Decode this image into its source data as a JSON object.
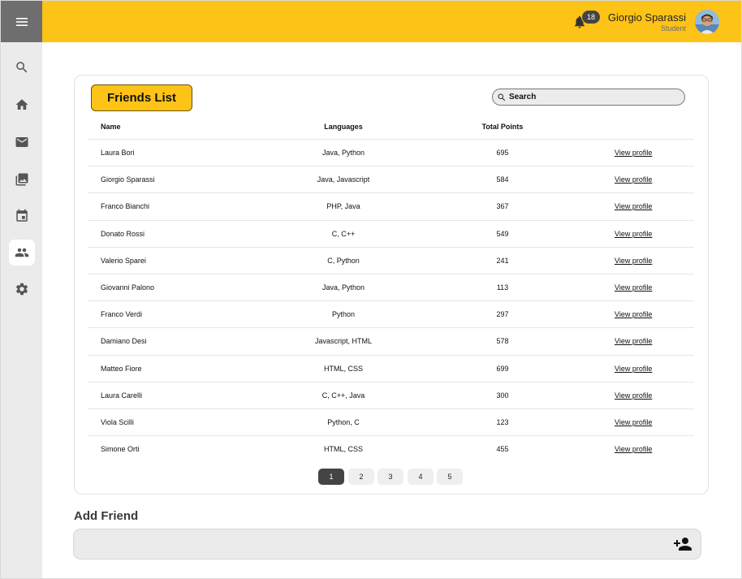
{
  "header": {
    "notifications_count": "18",
    "user_name": "Giorgio Sparassi",
    "user_role": "Student"
  },
  "sidebar": {
    "items": [
      {
        "icon": "search-icon"
      },
      {
        "icon": "home-icon"
      },
      {
        "icon": "mail-icon"
      },
      {
        "icon": "gallery-icon"
      },
      {
        "icon": "calendar-icon"
      },
      {
        "icon": "friends-icon",
        "active": true
      },
      {
        "icon": "settings-icon"
      }
    ]
  },
  "friends": {
    "title": "Friends List",
    "search_placeholder": "Search",
    "columns": [
      "Name",
      "Languages",
      "Total Points"
    ],
    "rows": [
      {
        "name": "Laura Bori",
        "languages": "Java, Python",
        "points": "695",
        "action": "View profile"
      },
      {
        "name": "Giorgio Sparassi",
        "languages": "Java, Javascript",
        "points": "584",
        "action": "View profile"
      },
      {
        "name": "Franco Bianchi",
        "languages": "PHP, Java",
        "points": "367",
        "action": "View profile"
      },
      {
        "name": "Donato Rossi",
        "languages": "C, C++",
        "points": "549",
        "action": "View profile"
      },
      {
        "name": "Valerio Sparei",
        "languages": "C, Python",
        "points": "241",
        "action": "View profile"
      },
      {
        "name": "Giovanni Palono",
        "languages": "Java, Python",
        "points": "113",
        "action": "View profile"
      },
      {
        "name": "Franco Verdi",
        "languages": "Python",
        "points": "297",
        "action": "View profile"
      },
      {
        "name": "Damiano Desi",
        "languages": "Javascript, HTML",
        "points": "578",
        "action": "View profile"
      },
      {
        "name": "Matteo Fiore",
        "languages": "HTML, CSS",
        "points": "699",
        "action": "View profile"
      },
      {
        "name": "Laura Carelli",
        "languages": "C, C++, Java",
        "points": "300",
        "action": "View profile"
      },
      {
        "name": "Viola Scilli",
        "languages": "Python, C",
        "points": "123",
        "action": "View profile"
      },
      {
        "name": "Simone Orti",
        "languages": "HTML, CSS",
        "points": "455",
        "action": "View profile"
      }
    ],
    "pages": [
      "1",
      "2",
      "3",
      "4",
      "5"
    ],
    "current_page": "1"
  },
  "add_friend": {
    "title": "Add Friend",
    "input_value": ""
  },
  "colors": {
    "accent": "#fdc316",
    "sidebar": "#ebebeb",
    "menu_block": "#6e6e6e"
  }
}
